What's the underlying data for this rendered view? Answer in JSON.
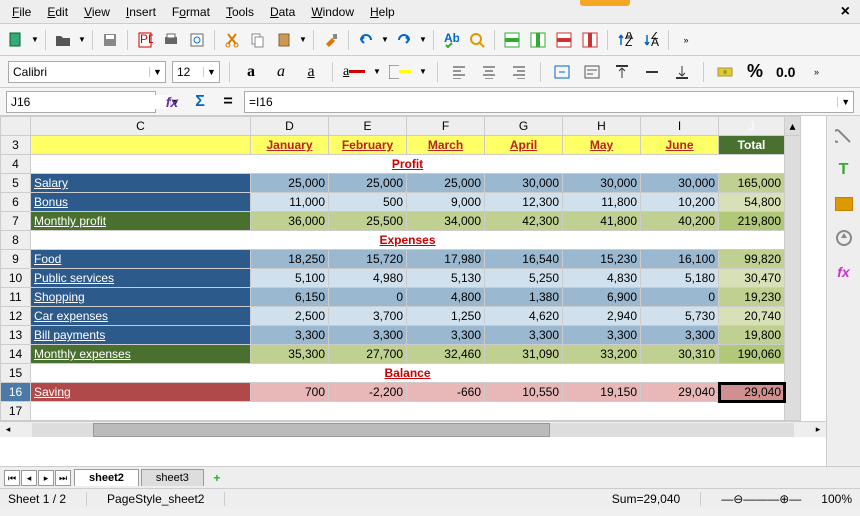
{
  "menu": {
    "file": "File",
    "edit": "Edit",
    "view": "View",
    "insert": "Insert",
    "format": "Format",
    "tools": "Tools",
    "data": "Data",
    "window": "Window",
    "help": "Help"
  },
  "font": {
    "name": "Calibri",
    "size": "12"
  },
  "cellref": "J16",
  "formula": "=I16",
  "cols": [
    "C",
    "D",
    "E",
    "F",
    "G",
    "H",
    "I",
    "J"
  ],
  "rows": [
    "3",
    "4",
    "5",
    "6",
    "7",
    "8",
    "9",
    "10",
    "11",
    "12",
    "13",
    "14",
    "15",
    "16",
    "17"
  ],
  "headers": {
    "jan": "January",
    "feb": "February",
    "mar": "March",
    "apr": "April",
    "may": "May",
    "jun": "June",
    "total": "Total"
  },
  "sections": {
    "profit": "Profit",
    "expenses": "Expenses",
    "balance": "Balance"
  },
  "labels": {
    "salary": "Salary",
    "bonus": "Bonus",
    "mprofit": "Monthly profit",
    "food": "Food",
    "pub": "Public services",
    "shop": "Shopping",
    "car": "Car expenses",
    "bill": "Bill payments",
    "mexp": "Monthly expenses",
    "saving": "Saving"
  },
  "data": {
    "salary": [
      "25,000",
      "25,000",
      "25,000",
      "30,000",
      "30,000",
      "30,000",
      "165,000"
    ],
    "bonus": [
      "11,000",
      "500",
      "9,000",
      "12,300",
      "11,800",
      "10,200",
      "54,800"
    ],
    "mprofit": [
      "36,000",
      "25,500",
      "34,000",
      "42,300",
      "41,800",
      "40,200",
      "219,800"
    ],
    "food": [
      "18,250",
      "15,720",
      "17,980",
      "16,540",
      "15,230",
      "16,100",
      "99,820"
    ],
    "pub": [
      "5,100",
      "4,980",
      "5,130",
      "5,250",
      "4,830",
      "5,180",
      "30,470"
    ],
    "shop": [
      "6,150",
      "0",
      "4,800",
      "1,380",
      "6,900",
      "0",
      "19,230"
    ],
    "car": [
      "2,500",
      "3,700",
      "1,250",
      "4,620",
      "2,940",
      "5,730",
      "20,740"
    ],
    "bill": [
      "3,300",
      "3,300",
      "3,300",
      "3,300",
      "3,300",
      "3,300",
      "19,800"
    ],
    "mexp": [
      "35,300",
      "27,700",
      "32,460",
      "31,090",
      "33,200",
      "30,310",
      "190,060"
    ],
    "saving": [
      "700",
      "-2,200",
      "-660",
      "10,550",
      "19,150",
      "29,040",
      "29,040"
    ]
  },
  "tabs": {
    "s2": "sheet2",
    "s3": "sheet3"
  },
  "status": {
    "sheet": "Sheet 1 / 2",
    "style": "PageStyle_sheet2",
    "sum": "Sum=29,040",
    "zoom": "100%"
  },
  "pct": "%",
  "num": "0.0"
}
